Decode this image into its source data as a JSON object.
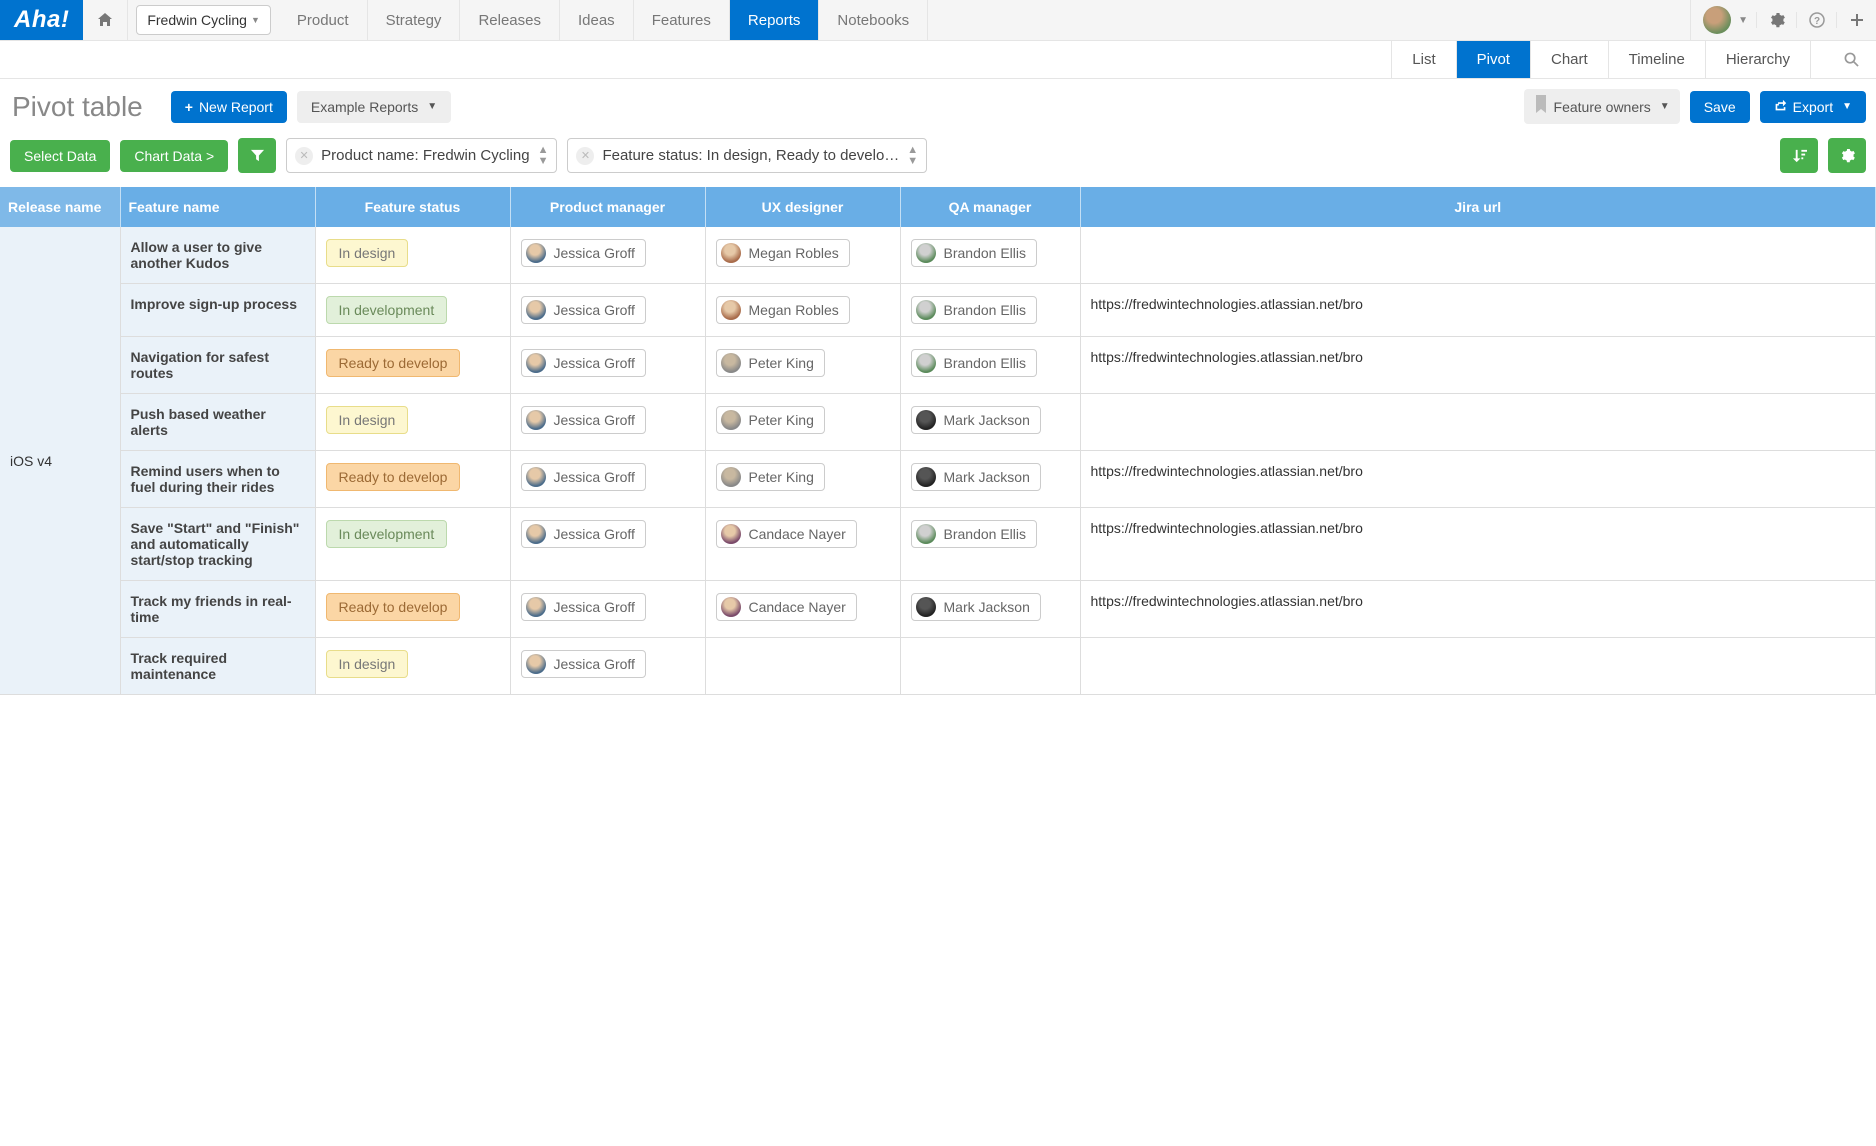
{
  "topbar": {
    "logo": "Aha!",
    "product_selector": "Fredwin Cycling",
    "nav": [
      "Product",
      "Strategy",
      "Releases",
      "Ideas",
      "Features",
      "Reports",
      "Notebooks"
    ],
    "active_nav": "Reports"
  },
  "subnav": {
    "items": [
      "List",
      "Pivot",
      "Chart",
      "Timeline",
      "Hierarchy"
    ],
    "active": "Pivot"
  },
  "page_title": "Pivot table",
  "toolbar": {
    "new_report": "New Report",
    "example_reports": "Example Reports",
    "select_data": "Select Data",
    "chart_data": "Chart Data >",
    "bookmark_label": "Feature owners",
    "save": "Save",
    "export": "Export"
  },
  "filters": [
    {
      "label": "Product name: Fredwin Cycling"
    },
    {
      "label": "Feature status: In design, Ready to develo…"
    }
  ],
  "columns": [
    "Release name",
    "Feature name",
    "Feature status",
    "Product manager",
    "UX designer",
    "QA manager",
    "Jira url"
  ],
  "release_name": "iOS v4",
  "status_labels": {
    "InDesign": "In design",
    "InDevelopment": "In development",
    "ReadyToDevelop": "Ready to develop"
  },
  "people": {
    "jessica": "Jessica Groff",
    "megan": "Megan Robles",
    "brandon": "Brandon Ellis",
    "peter": "Peter King",
    "mark": "Mark Jackson",
    "candace": "Candace Nayer"
  },
  "jira_url": "https://fredwintechnologies.atlassian.net/bro",
  "rows": [
    {
      "feature": "Allow a user to give another Kudos",
      "status": "InDesign",
      "pm": "jessica",
      "ux": "megan",
      "qa": "brandon",
      "jira": false
    },
    {
      "feature": "Improve sign-up process",
      "status": "InDevelopment",
      "pm": "jessica",
      "ux": "megan",
      "qa": "brandon",
      "jira": true
    },
    {
      "feature": "Navigation for safest routes",
      "status": "ReadyToDevelop",
      "pm": "jessica",
      "ux": "peter",
      "qa": "brandon",
      "jira": true
    },
    {
      "feature": "Push based weather alerts",
      "status": "InDesign",
      "pm": "jessica",
      "ux": "peter",
      "qa": "mark",
      "jira": false
    },
    {
      "feature": "Remind users when to fuel during their rides",
      "status": "ReadyToDevelop",
      "pm": "jessica",
      "ux": "peter",
      "qa": "mark",
      "jira": true
    },
    {
      "feature": "Save \"Start\" and \"Finish\" and automatically start/stop tracking",
      "status": "InDevelopment",
      "pm": "jessica",
      "ux": "candace",
      "qa": "brandon",
      "jira": true
    },
    {
      "feature": "Track my friends in real-time",
      "status": "ReadyToDevelop",
      "pm": "jessica",
      "ux": "candace",
      "qa": "mark",
      "jira": true
    },
    {
      "feature": "Track required maintenance",
      "status": "InDesign",
      "pm": "jessica",
      "ux": "",
      "qa": "",
      "jira": false
    }
  ],
  "avatar_classes": {
    "jessica": "av1",
    "megan": "av2",
    "brandon": "av3",
    "peter": "av4",
    "mark": "av5",
    "candace": "av6"
  }
}
